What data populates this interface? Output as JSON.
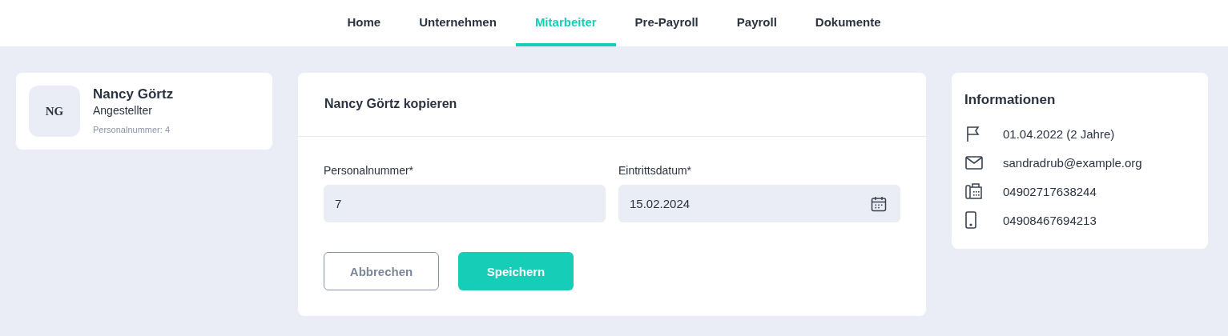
{
  "nav": [
    {
      "label": "Home",
      "selected": false
    },
    {
      "label": "Unternehmen",
      "selected": false
    },
    {
      "label": "Mitarbeiter",
      "selected": true
    },
    {
      "label": "Pre-Payroll",
      "selected": false
    },
    {
      "label": "Payroll",
      "selected": false
    },
    {
      "label": "Dokumente",
      "selected": false
    }
  ],
  "profile": {
    "initials": "NG",
    "name": "Nancy Görtz",
    "role": "Angestellter",
    "number_label": "Personalnummer:",
    "number": "4"
  },
  "form": {
    "title": "Nancy Görtz kopieren",
    "fields": [
      {
        "label": "Personalnummer*",
        "value": "7",
        "kind": "text"
      },
      {
        "label": "Eintrittsdatum*",
        "value": "15.02.2024",
        "kind": "date"
      }
    ],
    "buttons": [
      {
        "label": "Abbrechen",
        "kind": "secondary"
      },
      {
        "label": "Speichern",
        "kind": "primary"
      }
    ]
  },
  "info": {
    "title": "Informationen",
    "items": [
      {
        "kind": "start",
        "text": "01.04.2022 (2 Jahre)"
      },
      {
        "kind": "email",
        "text": "sandradrub@example.org"
      },
      {
        "kind": "phone",
        "text": "04902717638244"
      },
      {
        "kind": "mobile",
        "text": "04908467694213"
      }
    ]
  }
}
